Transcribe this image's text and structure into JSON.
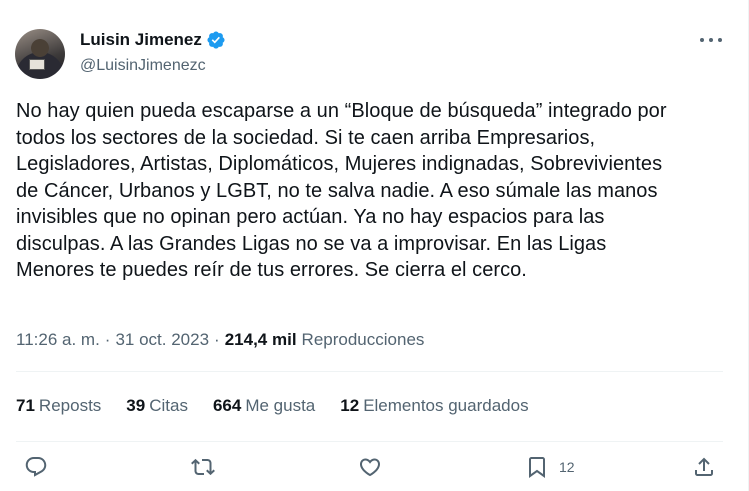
{
  "author": {
    "name": "Luisin Jimenez",
    "handle": "@LuisinJimenezc",
    "verified_color": "#1d9bf0"
  },
  "tweet": {
    "lines": [
      "No hay quien pueda escaparse a un “Bloque de búsqueda” integrado por",
      "todos los sectores de la sociedad. Si te caen arriba Empresarios,",
      "Legisladores, Artistas, Diplomáticos, Mujeres indignadas, Sobrevivientes",
      "de Cáncer, Urbanos y LGBT, no te salva nadie. A eso súmale las manos",
      "invisibles que no opinan pero actúan. Ya no hay espacios para las",
      "disculpas. A las Grandes Ligas no se va a improvisar. En las Ligas",
      "Menores te puedes reír de tus errores. Se cierra el cerco."
    ]
  },
  "meta": {
    "time": "11:26 a. m.",
    "separator": "·",
    "date": "31 oct. 2023",
    "views_count": "214,4 mil",
    "views_label": "Reproducciones"
  },
  "stats": [
    {
      "num": "71",
      "label": "Reposts"
    },
    {
      "num": "39",
      "label": "Citas"
    },
    {
      "num": "664",
      "label": "Me gusta"
    },
    {
      "num": "12",
      "label": "Elementos guardados"
    }
  ],
  "actions": {
    "icons": [
      "reply-icon",
      "repost-icon",
      "like-icon",
      "bookmark-icon",
      "share-icon"
    ],
    "bookmark_count": "12"
  }
}
